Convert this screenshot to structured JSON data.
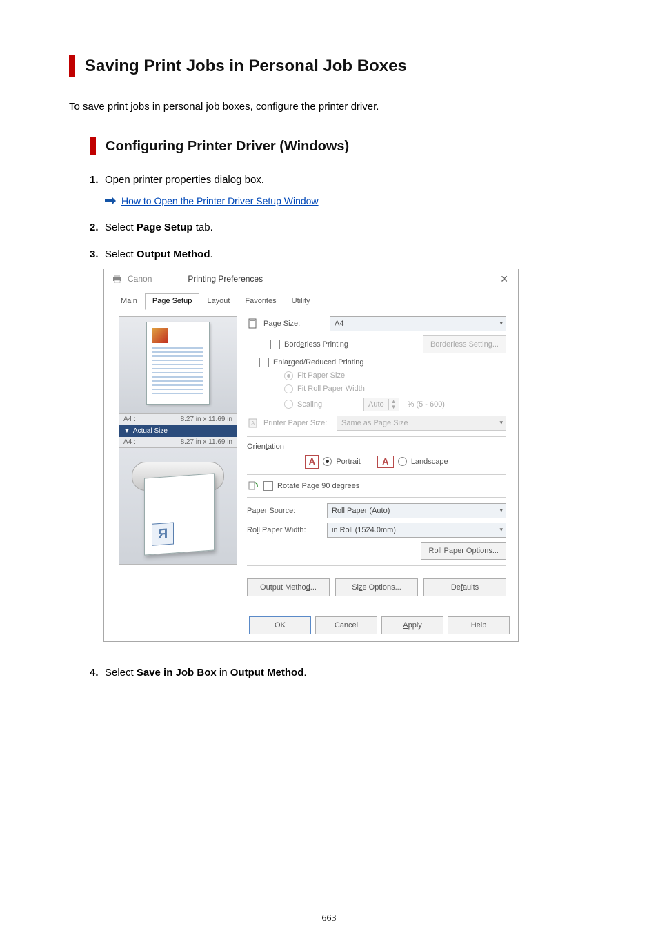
{
  "heading": "Saving Print Jobs in Personal Job Boxes",
  "intro": "To save print jobs in personal job boxes, configure the printer driver.",
  "sub_heading": "Configuring Printer Driver (Windows)",
  "steps": {
    "s1": {
      "num": "1.",
      "text": "Open printer properties dialog box.",
      "link": "How to Open the Printer Driver Setup Window"
    },
    "s2": {
      "num": "2.",
      "pre": "Select ",
      "bold": "Page Setup",
      "post": " tab."
    },
    "s3": {
      "num": "3.",
      "pre": "Select ",
      "bold": "Output Method",
      "post": "."
    },
    "s4": {
      "num": "4.",
      "pre": "Select ",
      "bold1": "Save in Job Box",
      "mid": " in ",
      "bold2": "Output Method",
      "post": "."
    }
  },
  "dialog": {
    "brand": "Canon",
    "title": "Printing Preferences",
    "tabs": [
      "Main",
      "Page Setup",
      "Layout",
      "Favorites",
      "Utility"
    ],
    "active_tab": 1,
    "preview": {
      "label_a4": "A4 :",
      "dims": "8.27 in x 11.69 in",
      "actual": "Actual Size"
    },
    "page_size_label": "Page Size:",
    "page_size_value": "A4",
    "borderless_chk": "Borderless Printing",
    "borderless_btn": "Borderless Setting...",
    "enlarged_chk": "Enlarged/Reduced Printing",
    "fit_paper": "Fit Paper Size",
    "fit_roll": "Fit Roll Paper Width",
    "scaling": "Scaling",
    "scaling_val": "Auto",
    "scaling_range": "% (5 - 600)",
    "printer_paper_label": "Printer Paper Size:",
    "printer_paper_value": "Same as Page Size",
    "orientation_label": "Orientation",
    "portrait": "Portrait",
    "landscape": "Landscape",
    "rotate_chk": "Rotate Page 90 degrees",
    "paper_source_label": "Paper Source:",
    "paper_source_value": "Roll Paper (Auto)",
    "roll_width_label": "Roll Paper Width:",
    "roll_width_value": "in Roll (1524.0mm)",
    "roll_options_btn": "Roll Paper Options...",
    "output_method_btn": "Output Method...",
    "size_options_btn": "Size Options...",
    "defaults_btn": "Defaults",
    "ok": "OK",
    "cancel": "Cancel",
    "apply": "Apply",
    "help": "Help"
  },
  "page_number": "663"
}
